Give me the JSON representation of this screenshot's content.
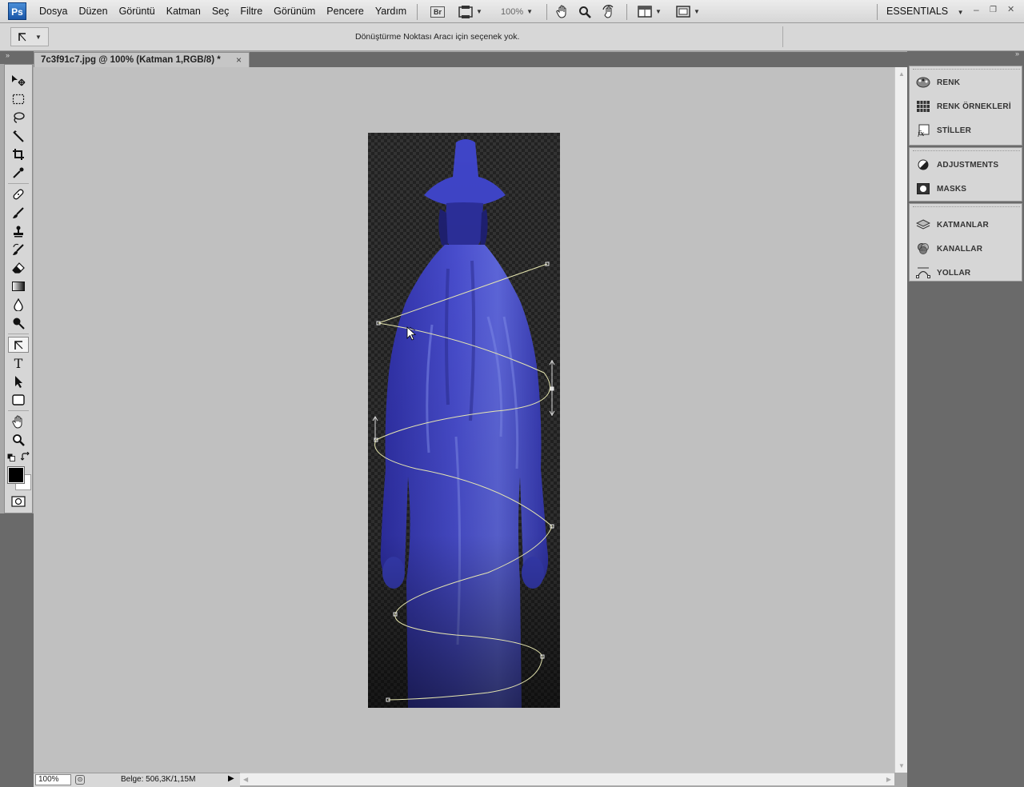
{
  "app": {
    "logo": "Ps"
  },
  "menu": [
    "Dosya",
    "Düzen",
    "Görüntü",
    "Katman",
    "Seç",
    "Filtre",
    "Görünüm",
    "Pencere",
    "Yardım"
  ],
  "appbar": {
    "bridge": "Br",
    "zoom": "100%",
    "workspace": "ESSENTIALS",
    "icons": [
      "bridge-icon",
      "mini-bridge-icon",
      "hand-icon",
      "zoom-icon",
      "rotate-view-icon",
      "arrange-documents-icon",
      "screen-mode-icon"
    ]
  },
  "window_controls": {
    "minimize": "–",
    "restore": "❐",
    "close": "✕"
  },
  "options": {
    "message": "Dönüştürme Noktası Aracı için seçenek yok."
  },
  "document": {
    "tab_title": "7c3f91c7.jpg @ 100% (Katman 1,RGB/8) *",
    "close": "×"
  },
  "tools": [
    "move-tool-icon",
    "marquee-tool-icon",
    "lasso-tool-icon",
    "magic-wand-tool-icon",
    "crop-tool-icon",
    "eyedropper-tool-icon",
    "healing-brush-tool-icon",
    "brush-tool-icon",
    "clone-stamp-tool-icon",
    "history-brush-tool-icon",
    "eraser-tool-icon",
    "gradient-tool-icon",
    "blur-tool-icon",
    "dodge-tool-icon",
    "convert-point-tool-icon",
    "type-tool-icon",
    "path-selection-tool-icon",
    "shape-tool-icon",
    "hand-tool-icon",
    "zoom-tool-icon"
  ],
  "colors": {
    "foreground": "#000000",
    "background": "#ffffff",
    "accent": "#3a3ac8",
    "path": "#e6e6b0"
  },
  "status": {
    "zoom": "100%",
    "doc_info": "Belge: 506,3K/1,15M"
  },
  "panels": {
    "group1": [
      "RENK",
      "RENK ÖRNEKLERİ",
      "STİLLER"
    ],
    "group2": [
      "ADJUSTMENTS",
      "MASKS"
    ],
    "group3": [
      "KATMANLAR",
      "KANALLAR",
      "YOLLAR"
    ]
  }
}
